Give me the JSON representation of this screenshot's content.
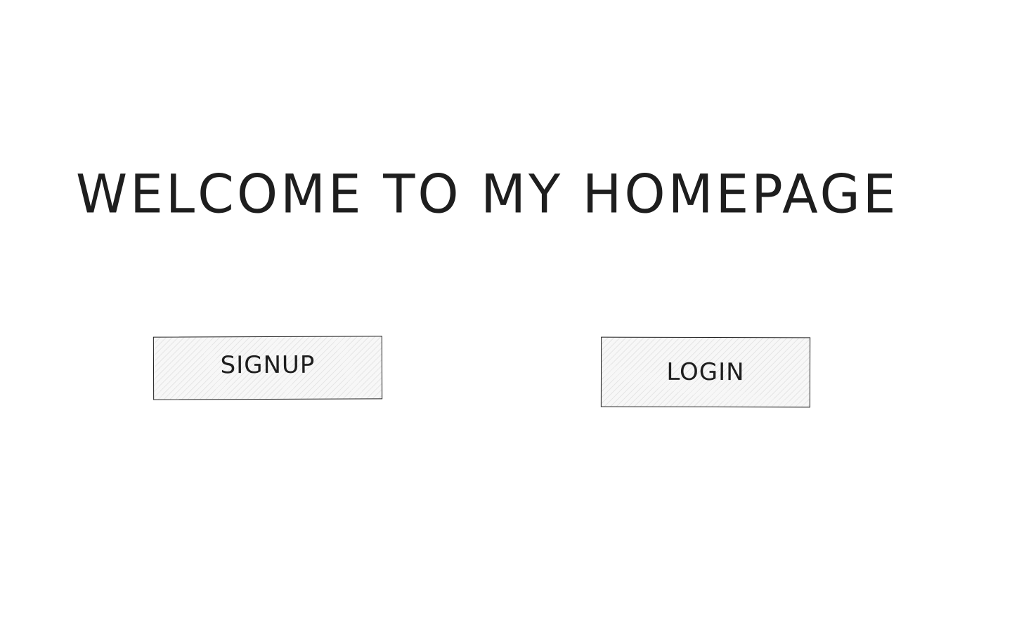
{
  "header": {
    "title": "WELCOME TO MY HOMEPAGE"
  },
  "actions": {
    "signup_label": "SIGNUP",
    "login_label": "LOGIN"
  },
  "colors": {
    "background": "#ffffff",
    "ink": "#1e1e1e",
    "button_fill": "#f7f7f7"
  }
}
